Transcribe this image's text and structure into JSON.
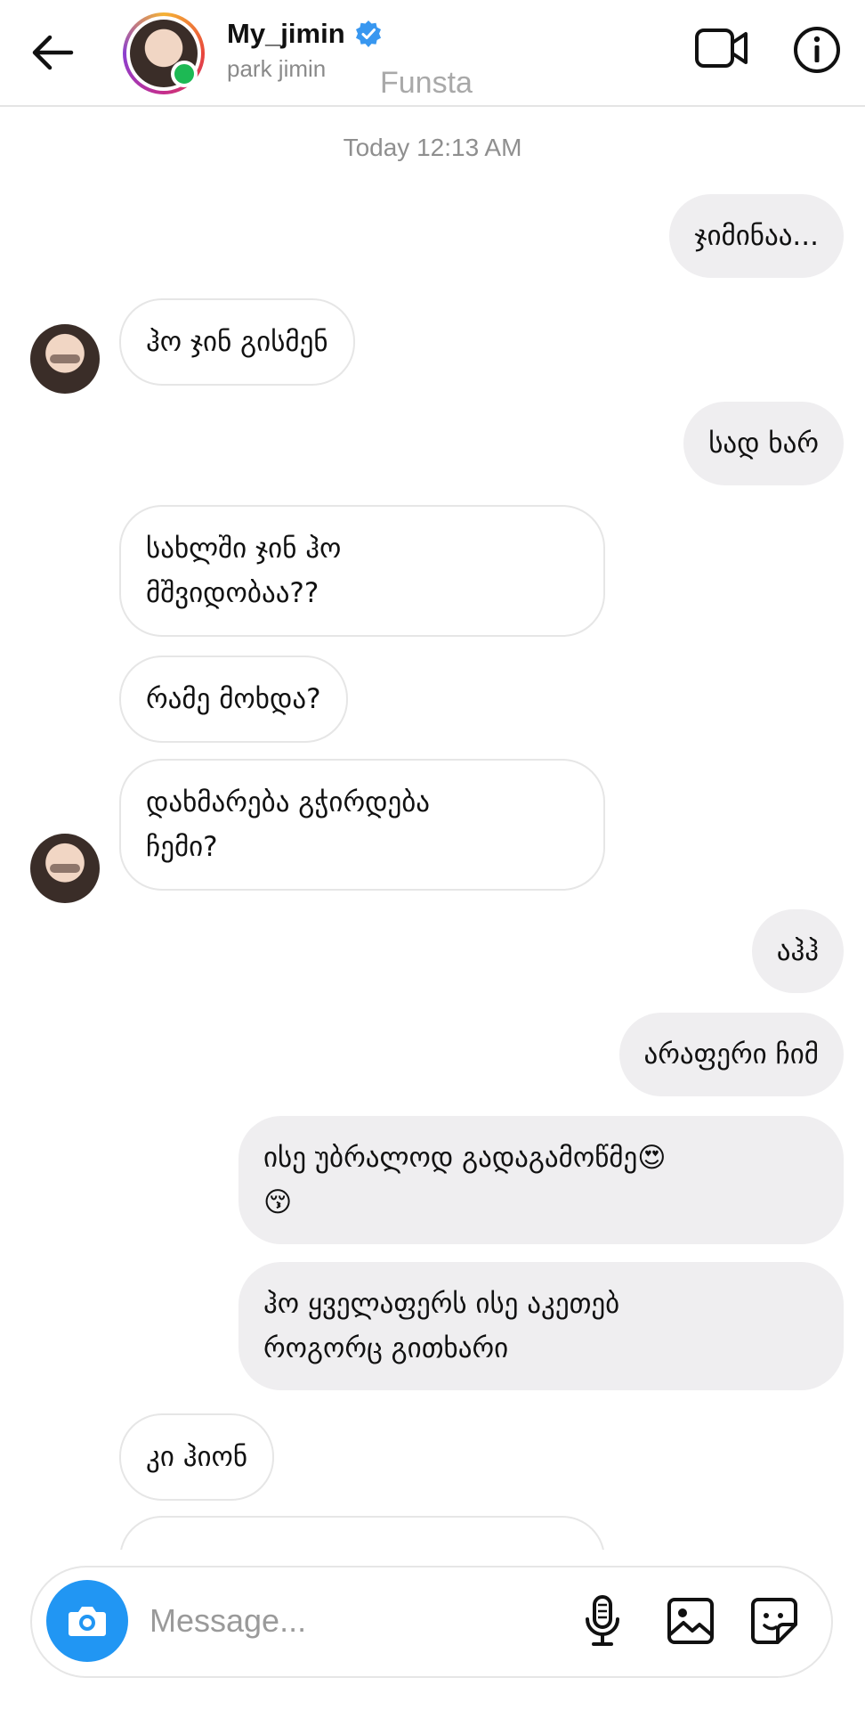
{
  "header": {
    "username": "My_jimin",
    "real_name": "park jimin",
    "overlay_text": "Funsta"
  },
  "chat": {
    "timestamp": "Today 12:13 AM",
    "messages": [
      {
        "from": "me",
        "text": "ჯიმინაა..."
      },
      {
        "from": "them",
        "text": "ჰო ჯინ გისმენ"
      },
      {
        "from": "me",
        "text": "სად ხარ"
      },
      {
        "from": "them",
        "text": "სახლში ჯინ ჰო\nმშვიდობაა??"
      },
      {
        "from": "them",
        "text": "რამე მოხდა?"
      },
      {
        "from": "them",
        "text": "დახმარება გჭირდება\nჩემი?"
      },
      {
        "from": "me",
        "text": "აჰჰ"
      },
      {
        "from": "me",
        "text": "არაფერი ჩიმ"
      },
      {
        "from": "me",
        "text": "ისე უბრალოდ გადაგამოწმე😍\n😚"
      },
      {
        "from": "me",
        "text": "ჰო ყველაფერს ისე აკეთებ\nროგორც გითხარი"
      },
      {
        "from": "them",
        "text": "კი ჰიონ"
      }
    ]
  },
  "composer": {
    "placeholder": "Message...",
    "accent_color": "#2196f3"
  },
  "icons": {
    "back": "arrow-left-icon",
    "verified": "verified-badge-icon",
    "video": "video-call-icon",
    "info": "info-icon",
    "camera": "camera-icon",
    "mic": "microphone-icon",
    "image": "image-icon",
    "sticker": "sticker-icon"
  }
}
